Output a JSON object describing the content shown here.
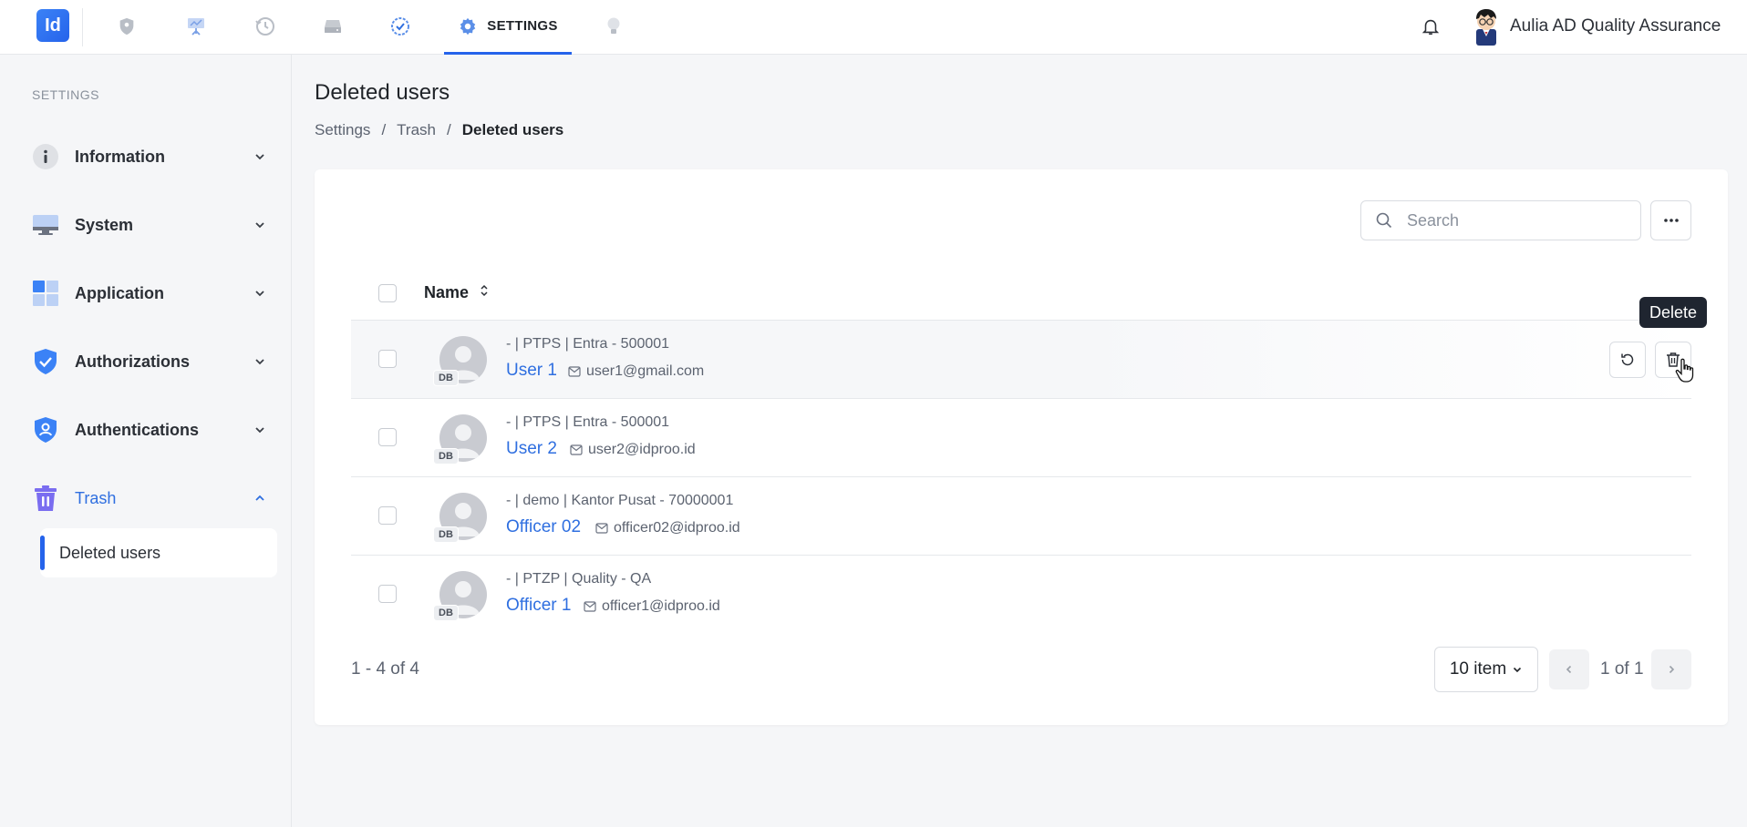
{
  "topbar": {
    "logo_text": "Id",
    "active_tab_label": "SETTINGS",
    "nav_icons": [
      "shield-icon",
      "presentation-icon",
      "history-icon",
      "drive-icon",
      "check-circle-icon",
      "gear-icon",
      "lightbulb-icon"
    ],
    "user_name": "Aulia AD Quality Assurance"
  },
  "sidebar": {
    "title": "SETTINGS",
    "items": [
      {
        "label": "Information",
        "icon": "info-icon"
      },
      {
        "label": "System",
        "icon": "monitor-icon"
      },
      {
        "label": "Application",
        "icon": "grid-icon"
      },
      {
        "label": "Authorizations",
        "icon": "shield-check-icon"
      },
      {
        "label": "Authentications",
        "icon": "shield-user-icon"
      },
      {
        "label": "Trash",
        "icon": "trash-icon"
      }
    ],
    "sub_item": "Deleted users"
  },
  "main": {
    "title": "Deleted users",
    "breadcrumb": [
      "Settings",
      "Trash",
      "Deleted users"
    ],
    "breadcrumb_sep": "/",
    "search_placeholder": "Search",
    "column_name": "Name",
    "rows": [
      {
        "meta": "- | PTPS | Entra - 500001",
        "name": "User 1",
        "email": "user1@gmail.com",
        "badge": "DB"
      },
      {
        "meta": "- | PTPS | Entra - 500001",
        "name": "User 2",
        "email": "user2@idproo.id",
        "badge": "DB"
      },
      {
        "meta": "- | demo | Kantor Pusat - 70000001",
        "name": "Officer 02",
        "email": "officer02@idproo.id",
        "badge": "DB"
      },
      {
        "meta": "- | PTZP | Quality - QA",
        "name": "Officer 1",
        "email": "officer1@idproo.id",
        "badge": "DB"
      }
    ],
    "tooltip": "Delete",
    "footer_count": "1 - 4 of 4",
    "page_size": "10 item",
    "page_text": "1 of 1"
  },
  "colors": {
    "accent": "#2563eb",
    "link": "#2f6fe0",
    "tooltip_bg": "#1f2530"
  }
}
